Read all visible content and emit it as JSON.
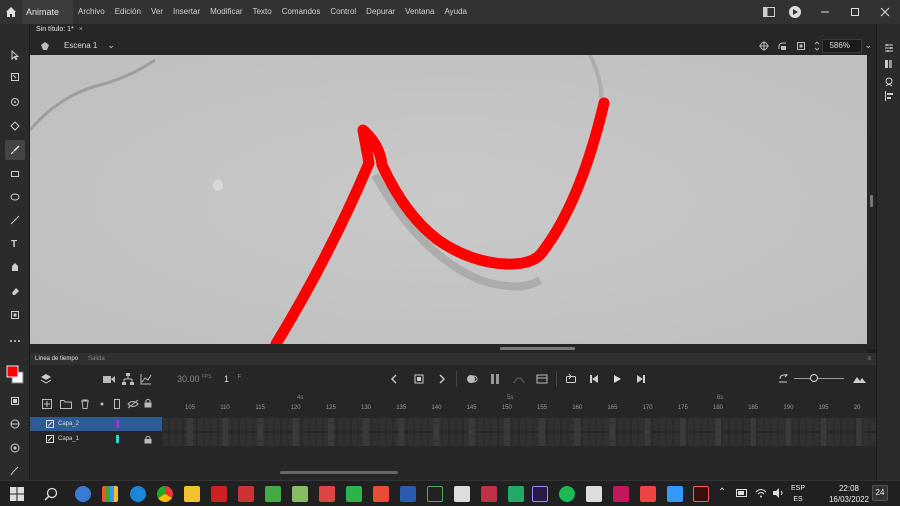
{
  "app": {
    "name": "Animate"
  },
  "menu": [
    "Archivo",
    "Edición",
    "Ver",
    "Insertar",
    "Modificar",
    "Texto",
    "Comandos",
    "Control",
    "Depurar",
    "Ventana",
    "Ayuda"
  ],
  "document": {
    "tab_title": "Sin título: 1*",
    "close_glyph": "×"
  },
  "scene": {
    "label": "Escena 1",
    "zoom": "586%"
  },
  "timeline": {
    "tabs": [
      "Línea de tiempo",
      "Salida"
    ],
    "fps": "30.00",
    "fps_unit": "FPS",
    "frame": "1",
    "frame_unit": "F",
    "seconds": [
      "4s",
      "5s",
      "6s"
    ],
    "ruler": [
      "105",
      "110",
      "115",
      "120",
      "125",
      "130",
      "135",
      "140",
      "145",
      "150",
      "155",
      "160",
      "165",
      "170",
      "175",
      "180",
      "185",
      "190",
      "195",
      "20"
    ],
    "layers": [
      {
        "name": "Capa_2",
        "color": "#8a3bd6",
        "selected": true,
        "locked": false
      },
      {
        "name": "Capa_1",
        "color": "#33d0d8",
        "selected": false,
        "locked": true
      }
    ]
  },
  "colors": {
    "stroke": "#ff0000",
    "fill": "#ffffff"
  },
  "taskbar": {
    "lang_top": "ESP",
    "lang_bottom": "ES",
    "time": "22:08",
    "date": "16/03/2022",
    "notifications": "24"
  }
}
